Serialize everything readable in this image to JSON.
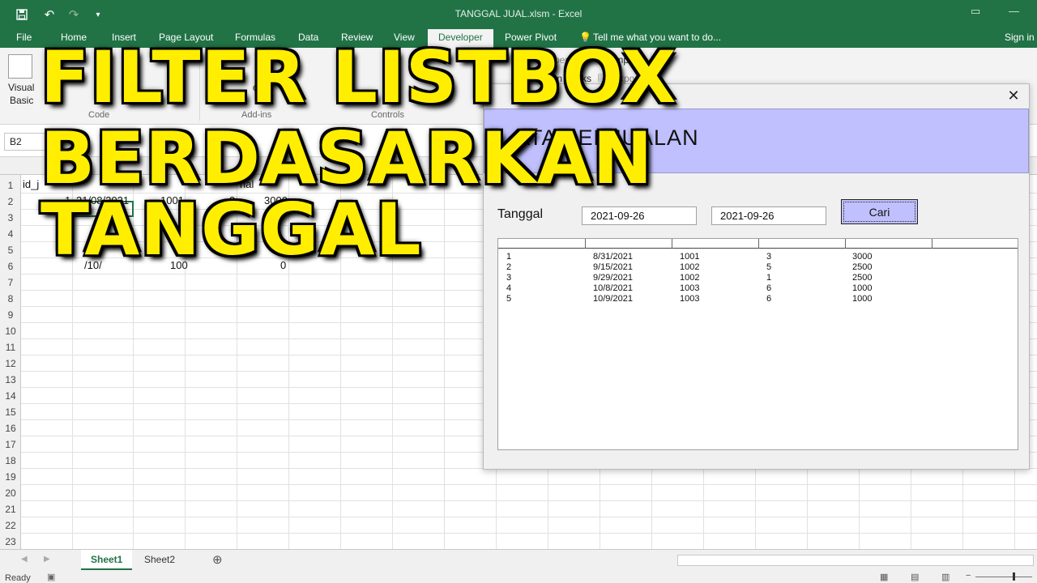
{
  "window": {
    "title": "TANGGAL JUAL.xlsm - Excel",
    "sign_in": "Sign in",
    "tell_me": "Tell me what you want to do..."
  },
  "qat": {
    "save_icon": "save-icon",
    "undo_icon": "undo-icon",
    "redo_icon": "redo-icon",
    "customize_icon": "customize-qat-icon"
  },
  "ribbon_tabs": [
    "File",
    "Home",
    "Insert",
    "Page Layout",
    "Formulas",
    "Data",
    "Review",
    "View",
    "Developer",
    "Power Pivot"
  ],
  "active_tab": "Developer",
  "ribbon": {
    "visual_basic_1": "Visual",
    "visual_basic_2": "Basic",
    "groups": {
      "code": "Code",
      "addins": "Add-ins",
      "controls": "Controls"
    },
    "import": "Import",
    "export": "Export",
    "properties_partial": "perties",
    "expansion_packs_partial": "ion Packs",
    "active_partial": "tive",
    "excel_partial": "cel",
    "ins_partial": "ins"
  },
  "formula_bar": {
    "name_box": "B2"
  },
  "grid": {
    "rows": [
      "1",
      "2",
      "3",
      "4",
      "5",
      "6",
      "7",
      "8",
      "9",
      "10",
      "11",
      "12",
      "13",
      "14",
      "15",
      "16",
      "17",
      "18",
      "19",
      "20",
      "21",
      "22",
      "23"
    ],
    "visible_cells": {
      "a1": "id_j",
      "a2": "1",
      "b2": "31/08/2021",
      "c2": "1001",
      "d2": "3",
      "e2": "3000",
      "e1_partial": "hal",
      "b3_partial": "20",
      "e3_partial": "25",
      "b6_partial": "/10/",
      "c6_partial": "100",
      "e6_partial": "0"
    }
  },
  "overlay": {
    "line1": "FILTER LISTBOX",
    "line2": "BERDASARKAN",
    "line3": "TANGGAL"
  },
  "userform": {
    "header": "ATA PENJUALAN",
    "label_tanggal": "Tanggal",
    "date_from": "2021-09-26",
    "date_to": "2021-09-26",
    "search_button": "Cari",
    "close_icon": "close-icon",
    "listbox_rows": [
      {
        "id": "1",
        "tanggal": "8/31/2021",
        "kode": "1001",
        "qty": "3",
        "harga": "3000"
      },
      {
        "id": "2",
        "tanggal": "9/15/2021",
        "kode": "1002",
        "qty": "5",
        "harga": "2500"
      },
      {
        "id": "3",
        "tanggal": "9/29/2021",
        "kode": "1002",
        "qty": "1",
        "harga": "2500"
      },
      {
        "id": "4",
        "tanggal": "10/8/2021",
        "kode": "1003",
        "qty": "6",
        "harga": "1000"
      },
      {
        "id": "5",
        "tanggal": "10/9/2021",
        "kode": "1003",
        "qty": "6",
        "harga": "1000"
      }
    ]
  },
  "sheets": [
    "Sheet1",
    "Sheet2"
  ],
  "active_sheet": "Sheet1",
  "status": {
    "ready": "Ready"
  },
  "colors": {
    "excel_green": "#217346",
    "form_header": "#c0c0ff",
    "overlay_yellow": "#ffee00"
  }
}
